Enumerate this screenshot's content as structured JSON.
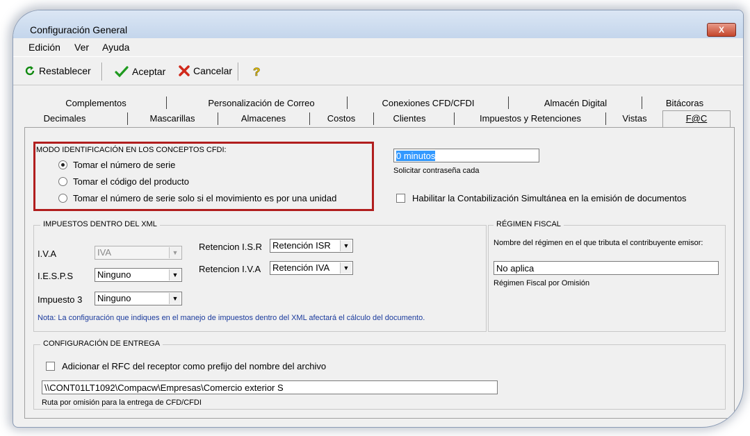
{
  "window": {
    "title": "Configuración General",
    "close_label": "X"
  },
  "menu": [
    "Edición",
    "Ver",
    "Ayuda"
  ],
  "toolbar": {
    "reset": "Restablecer",
    "accept": "Aceptar",
    "cancel": "Cancelar"
  },
  "tabs_row1": [
    "Complementos",
    "Personalización de Correo",
    "Conexiones CFD/CFDI",
    "Almacén Digital",
    "Bitácoras"
  ],
  "tabs_row2": [
    "Decimales",
    "Mascarillas",
    "Almacenes",
    "Costos",
    "Clientes",
    "Impuestos y Retenciones",
    "Vistas",
    "F@C"
  ],
  "modo": {
    "title": "MODO IDENTIFICACIÓN EN LOS CONCEPTOS CFDI:",
    "options": [
      "Tomar el número de serie",
      "Tomar el código del producto",
      "Tomar el número de serie solo si el movimiento es por una unidad"
    ],
    "selected_index": 0
  },
  "password": {
    "value": "0 minutos",
    "label": "Solicitar contraseña cada"
  },
  "contab": {
    "label": "Habilitar la Contabilización Simultánea en la emisión de documentos",
    "checked": false
  },
  "impuestos": {
    "title": "IMPUESTOS DENTRO DEL XML",
    "iva_label": "I.V.A",
    "iva_value": "IVA",
    "ieps_label": "I.E.S.P.S",
    "ieps_value": "Ninguno",
    "imp3_label": "Impuesto 3",
    "imp3_value": "Ninguno",
    "ret_isr_label": "Retencion I.S.R",
    "ret_isr_value": "Retención ISR",
    "ret_iva_label": "Retencion I.V.A",
    "ret_iva_value": "Retención IVA",
    "note": "Nota: La configuración que indiques en el manejo de impuestos dentro del XML afectará el cálculo del documento."
  },
  "regimen": {
    "title": "RÉGIMEN FISCAL",
    "prompt": "Nombre del régimen en el que tributa el contribuyente emisor:",
    "value": "No aplica",
    "caption": "Régimen Fiscal por Omisión"
  },
  "entrega": {
    "title": "CONFIGURACIÓN DE ENTREGA",
    "rfc_label": "Adicionar el RFC del receptor como prefijo del nombre del archivo",
    "path_value": "\\\\CONT01LT1092\\Compacw\\Empresas\\Comercio exterior S",
    "path_caption": "Ruta por omisión para la entrega de CFD/CFDI"
  },
  "colors": {
    "highlight_border": "#b11e1e",
    "selection": "#3399ff",
    "note_text": "#1a3a9c"
  }
}
